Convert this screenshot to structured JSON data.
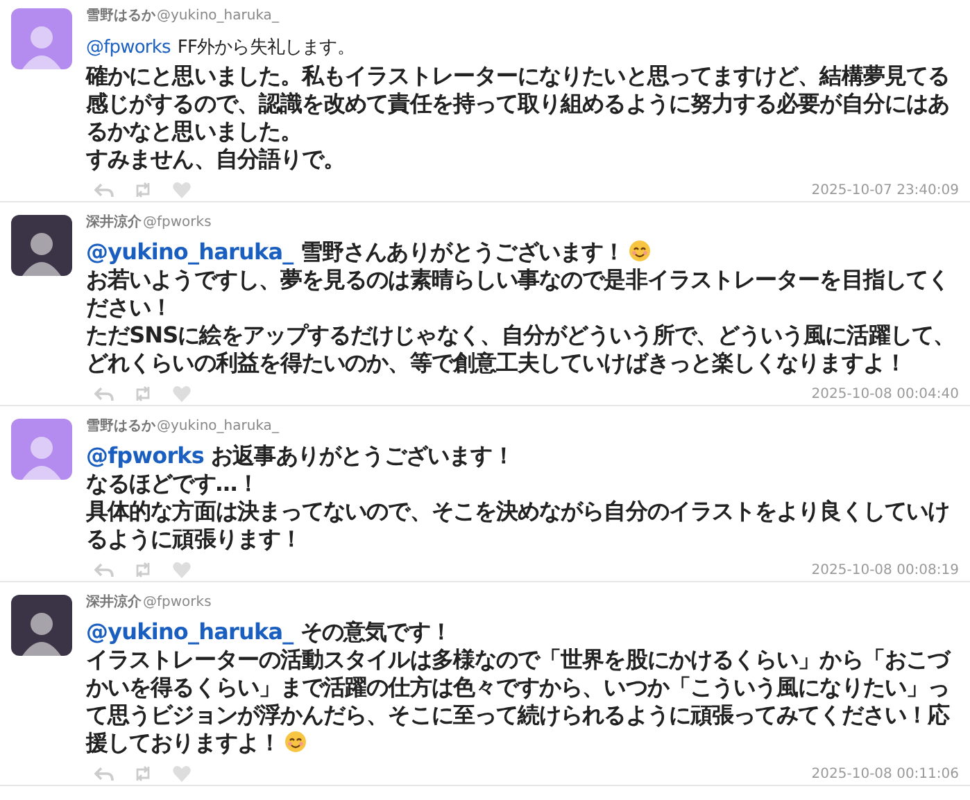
{
  "tweets": [
    {
      "name": "雪野はるか",
      "handle": "@yukino_haruka_",
      "color": "#b48cf0",
      "kind": "intro",
      "mention": "@fpworks",
      "lead": "FF外から失礼します。",
      "lead_emoji": false,
      "paragraphs": [
        {
          "text": "確かにと思いました。私もイラストレーターになりたいと思ってますけど、結構夢見てる感じがするので、認識を改めて責任を持って取り組めるように努力する必要が自分にはあるかなと思いました。",
          "emoji": false
        },
        {
          "text": "すみません、自分語りで。",
          "emoji": false
        }
      ],
      "time": "2025-10-07 23:40:09"
    },
    {
      "name": "深井涼介",
      "handle": "@fpworks",
      "color": "#3b3446",
      "kind": "reply",
      "mention": "@yukino_haruka_",
      "lead": "雪野さんありがとうございます！",
      "lead_emoji": true,
      "paragraphs": [
        {
          "text": "お若いようですし、夢を見るのは素晴らしい事なので是非イラストレーターを目指してください！",
          "emoji": false
        },
        {
          "text": "ただSNSに絵をアップするだけじゃなく、自分がどういう所で、どういう風に活躍して、どれくらいの利益を得たいのか、等で創意工夫していけばきっと楽しくなりますよ！",
          "emoji": false
        }
      ],
      "time": "2025-10-08 00:04:40"
    },
    {
      "name": "雪野はるか",
      "handle": "@yukino_haruka_",
      "color": "#b48cf0",
      "kind": "reply",
      "mention": "@fpworks",
      "lead": "お返事ありがとうございます！",
      "lead_emoji": false,
      "paragraphs": [
        {
          "text": "なるほどです…！",
          "emoji": false
        },
        {
          "text": "具体的な方面は決まってないので、そこを決めながら自分のイラストをより良くしていけるように頑張ります！",
          "emoji": false
        }
      ],
      "time": "2025-10-08 00:08:19"
    },
    {
      "name": "深井涼介",
      "handle": "@fpworks",
      "color": "#3b3446",
      "kind": "reply",
      "mention": "@yukino_haruka_",
      "lead": "その意気です！",
      "lead_emoji": false,
      "paragraphs": [
        {
          "text": "イラストレーターの活動スタイルは多様なので「世界を股にかけるくらい」から「おこづかいを得るくらい」まで活躍の仕方は色々ですから、いつか「こういう風になりたい」って思うビジョンが浮かんだら、そこに至って続けられるように頑張ってみてください！応援しておりますよ！",
          "emoji": true
        }
      ],
      "time": "2025-10-08 00:11:06"
    }
  ]
}
